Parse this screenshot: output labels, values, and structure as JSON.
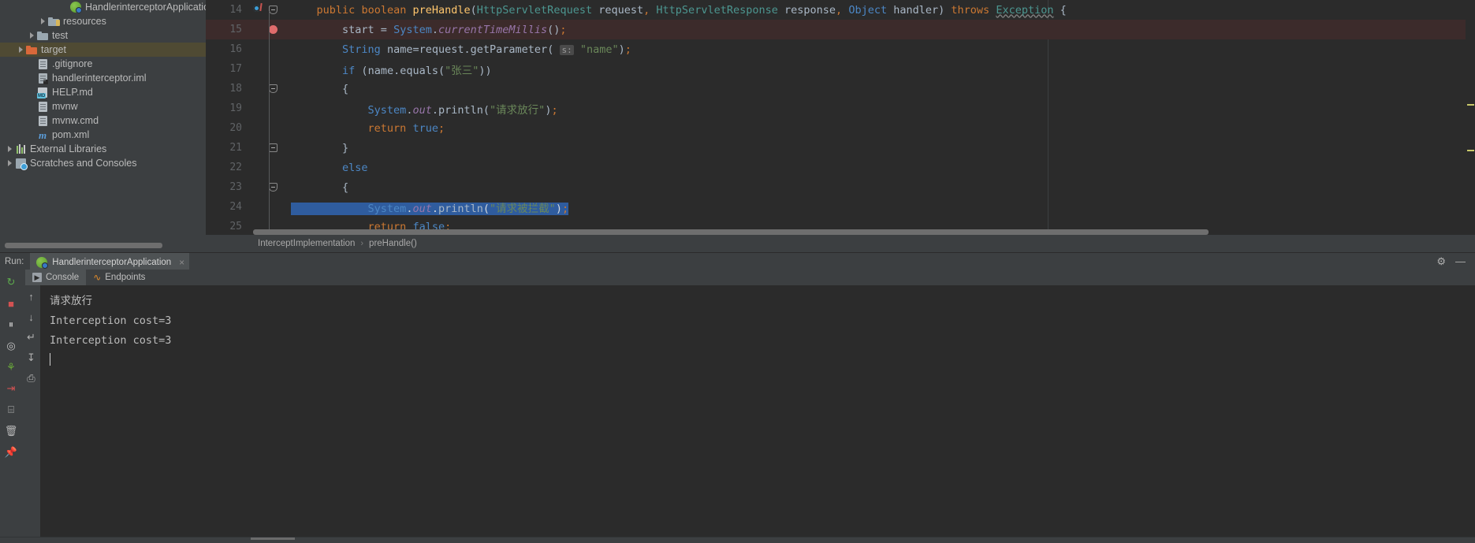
{
  "project_tree": {
    "items": [
      {
        "label": "HandlerinterceptorApplication",
        "icon": "springboot-class-icon",
        "indent": 5,
        "arrow": "none",
        "selected": false
      },
      {
        "label": "resources",
        "icon": "resources-folder-icon",
        "indent": 3,
        "arrow": "collapsed",
        "selected": false
      },
      {
        "label": "test",
        "icon": "folder-icon",
        "indent": 2,
        "arrow": "collapsed",
        "selected": false
      },
      {
        "label": "target",
        "icon": "folder-orange-icon",
        "indent": 1,
        "arrow": "collapsed",
        "selected": true
      },
      {
        "label": ".gitignore",
        "icon": "file-icon",
        "indent": 2,
        "arrow": "none",
        "selected": false
      },
      {
        "label": "handlerinterceptor.iml",
        "icon": "iml-file-icon",
        "indent": 2,
        "arrow": "none",
        "selected": false
      },
      {
        "label": "HELP.md",
        "icon": "markdown-file-icon",
        "indent": 2,
        "arrow": "none",
        "selected": false
      },
      {
        "label": "mvnw",
        "icon": "file-icon",
        "indent": 2,
        "arrow": "none",
        "selected": false
      },
      {
        "label": "mvnw.cmd",
        "icon": "file-icon",
        "indent": 2,
        "arrow": "none",
        "selected": false
      },
      {
        "label": "pom.xml",
        "icon": "maven-file-icon",
        "indent": 2,
        "arrow": "none",
        "selected": false
      },
      {
        "label": "External Libraries",
        "icon": "libraries-icon",
        "indent": 0,
        "arrow": "collapsed",
        "selected": false
      },
      {
        "label": "Scratches and Consoles",
        "icon": "scratches-icon",
        "indent": 0,
        "arrow": "collapsed",
        "selected": false
      }
    ]
  },
  "editor": {
    "lines": [
      {
        "num": "14",
        "marker": "run-gutter-icon",
        "fold": "fold-collapse",
        "text": "    public boolean preHandle(HttpServletRequest request, HttpServletResponse response, Object handler) throws Exception {"
      },
      {
        "num": "15",
        "marker": "breakpoint-icon",
        "fold": "none",
        "highlight": "breakpoint-line",
        "text": "        start = System.currentTimeMillis();"
      },
      {
        "num": "16",
        "marker": "none",
        "fold": "none",
        "text": "        String name=request.getParameter( s: \"name\");"
      },
      {
        "num": "17",
        "marker": "none",
        "fold": "none",
        "text": "        if (name.equals(\"张三\"))"
      },
      {
        "num": "18",
        "marker": "none",
        "fold": "fold-collapse",
        "text": "        {"
      },
      {
        "num": "19",
        "marker": "none",
        "fold": "none",
        "text": "            System.out.println(\"请求放行\");"
      },
      {
        "num": "20",
        "marker": "none",
        "fold": "none",
        "text": "            return true;"
      },
      {
        "num": "21",
        "marker": "none",
        "fold": "fold-end",
        "text": "        }"
      },
      {
        "num": "22",
        "marker": "none",
        "fold": "none",
        "text": "        else"
      },
      {
        "num": "23",
        "marker": "none",
        "fold": "fold-collapse",
        "text": "        {"
      },
      {
        "num": "24",
        "marker": "none",
        "fold": "none",
        "selected": true,
        "text": "            System.out.println(\"请求被拦截\");"
      },
      {
        "num": "25",
        "marker": "none",
        "fold": "none",
        "text": "            return false;"
      }
    ],
    "param_hint": "s:",
    "breadcrumb": {
      "class": "InterceptImplementation",
      "separator": "›",
      "method": "preHandle()"
    }
  },
  "run_panel": {
    "run_label": "Run:",
    "tab_title": "HandlerinterceptorApplication",
    "tab_close": "×",
    "settings_icon": "gear-icon",
    "minimize_icon": "minimize-icon",
    "toolbar_left": [
      {
        "name": "rerun-icon",
        "glyph": "↻",
        "color": "#5dab4c"
      },
      {
        "name": "stop-icon",
        "glyph": "■",
        "color": "#d25252"
      },
      {
        "name": "pause-icon",
        "glyph": "⏸",
        "color": "#b8b8b8"
      },
      {
        "name": "camera-dump-icon",
        "glyph": "◎",
        "color": "#c4c4c4"
      },
      {
        "name": "thread-dump-icon",
        "glyph": "⚘",
        "color": "#6aaa3a"
      },
      {
        "name": "exit-icon",
        "glyph": "⇥",
        "color": "#d25252"
      },
      {
        "name": "layout-icon",
        "glyph": "⌸",
        "color": "#b8b8b8"
      },
      {
        "name": "trash-icon",
        "glyph": "🗑",
        "color": "#b8b8b8"
      },
      {
        "name": "pin-icon",
        "glyph": "📌",
        "color": "#9fb6c9"
      }
    ],
    "toolbar_console": [
      {
        "name": "scroll-up-icon",
        "glyph": "↑"
      },
      {
        "name": "scroll-down-icon",
        "glyph": "↓"
      },
      {
        "name": "soft-wrap-icon",
        "glyph": "↵"
      },
      {
        "name": "scroll-to-end-icon",
        "glyph": "↧"
      },
      {
        "name": "print-icon",
        "glyph": "⎙"
      }
    ],
    "tabs": [
      {
        "label": "Console",
        "icon": "console-icon",
        "active": true
      },
      {
        "label": "Endpoints",
        "icon": "endpoints-icon",
        "active": false
      }
    ],
    "console_output": [
      "请求放行",
      "Interception cost=3",
      "Interception cost=3"
    ]
  },
  "colors": {
    "editor_bg": "#2b2b2b",
    "panel_bg": "#3c3f41",
    "selection": "#2f5c9e",
    "breakpoint_line": "#3c2b2b",
    "tree_selection": "#4f4a33",
    "keyword": "#cc7832",
    "string": "#6a8759",
    "field": "#9876aa",
    "type": "#4c9690",
    "method": "#ffc66d",
    "text": "#a9b7c6"
  }
}
